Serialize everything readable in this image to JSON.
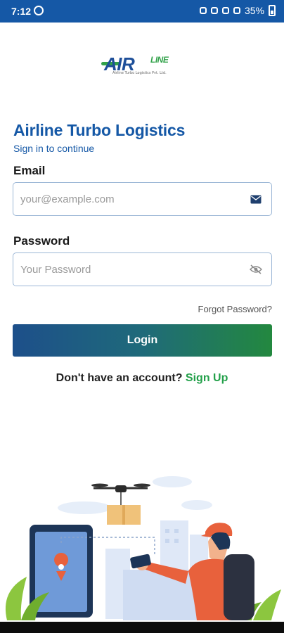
{
  "status_bar": {
    "time": "7:12",
    "battery": "35%"
  },
  "logo": {
    "text_main": "AIR",
    "text_accent": "LINE",
    "tagline": "Airline Turbo Logistics Pvt. Ltd."
  },
  "header": {
    "title": "Airline Turbo Logistics",
    "subtitle": "Sign in to continue"
  },
  "form": {
    "email_label": "Email",
    "email_placeholder": "your@example.com",
    "email_value": "",
    "password_label": "Password",
    "password_placeholder": "Your Password",
    "password_value": "",
    "forgot_link": "Forgot Password?",
    "login_button": "Login",
    "signup_prompt": "Don't have an account?",
    "signup_link": "Sign Up"
  },
  "colors": {
    "brand_blue": "#1558a6",
    "brand_green": "#23a04a",
    "button_start": "#1d4f8a",
    "button_end": "#23883f"
  },
  "icons": {
    "email_field_icon": "envelope-icon",
    "password_field_icon": "eye-off-icon"
  }
}
